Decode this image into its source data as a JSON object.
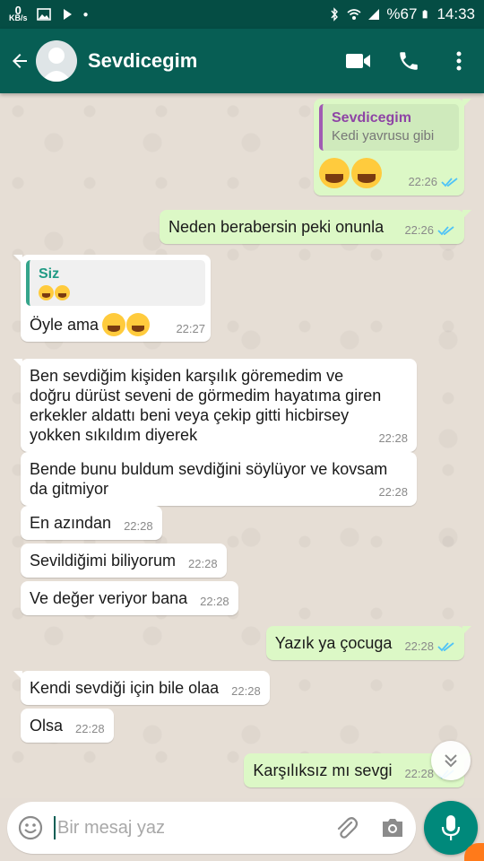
{
  "status_bar": {
    "net_speed_value": "0",
    "net_speed_unit": "KB/s",
    "battery": "%67",
    "time": "14:33"
  },
  "header": {
    "contact_name": "Sevdicegim"
  },
  "messages": [
    {
      "dir": "out",
      "quote_name": "Sevdicegim",
      "quote_text": "Kedi yavrusu gibi",
      "time": "22:26",
      "emoji": "😂😂"
    },
    {
      "dir": "out",
      "text": "Neden berabersin peki onunla",
      "time": "22:26"
    },
    {
      "dir": "in",
      "quote_name": "Siz",
      "quote_emoji": "😂😂",
      "text": "Öyle ama",
      "emoji": "😂😂",
      "time": "22:27"
    },
    {
      "dir": "in",
      "lines": [
        "Ben sevdiğim kişiden karşılık göremedim ve",
        "doğru dürüst seveni de görmedim hayatıma giren",
        "erkekler aldattı beni veya çekip gitti hicbirsey",
        "yokken sıkıldım diyerek"
      ],
      "time": "22:28"
    },
    {
      "dir": "in",
      "lines": [
        "Bende bunu buldum sevdiğini söylüyor ve kovsam",
        "da gitmiyor"
      ],
      "time": "22:28"
    },
    {
      "dir": "in",
      "text": "En azından",
      "time": "22:28"
    },
    {
      "dir": "in",
      "text": "Sevildiğimi biliyorum",
      "time": "22:28"
    },
    {
      "dir": "in",
      "text": "Ve değer veriyor bana",
      "time": "22:28"
    },
    {
      "dir": "out",
      "text": "Yazık ya çocuga",
      "time": "22:28"
    },
    {
      "dir": "in",
      "text": "Kendi sevdiği için bile olaa",
      "time": "22:28"
    },
    {
      "dir": "in",
      "text": "Olsa",
      "time": "22:28"
    },
    {
      "dir": "out",
      "text": "Karşılıksız mı sevgi",
      "time": "22:28"
    }
  ],
  "input": {
    "placeholder": "Bir mesaj yaz"
  },
  "colors": {
    "header": "#075e54",
    "status_bar": "#054d44",
    "outgoing_bubble": "#dcf8c6",
    "incoming_bubble": "#ffffff",
    "read_ticks": "#4fc3f7",
    "mic_button": "#00897b"
  },
  "icons": [
    "back-arrow-icon",
    "avatar-icon",
    "video-call-icon",
    "phone-icon",
    "more-vert-icon",
    "emoji-icon",
    "attach-icon",
    "camera-icon",
    "mic-icon",
    "scroll-down-icon",
    "double-tick-icon"
  ]
}
